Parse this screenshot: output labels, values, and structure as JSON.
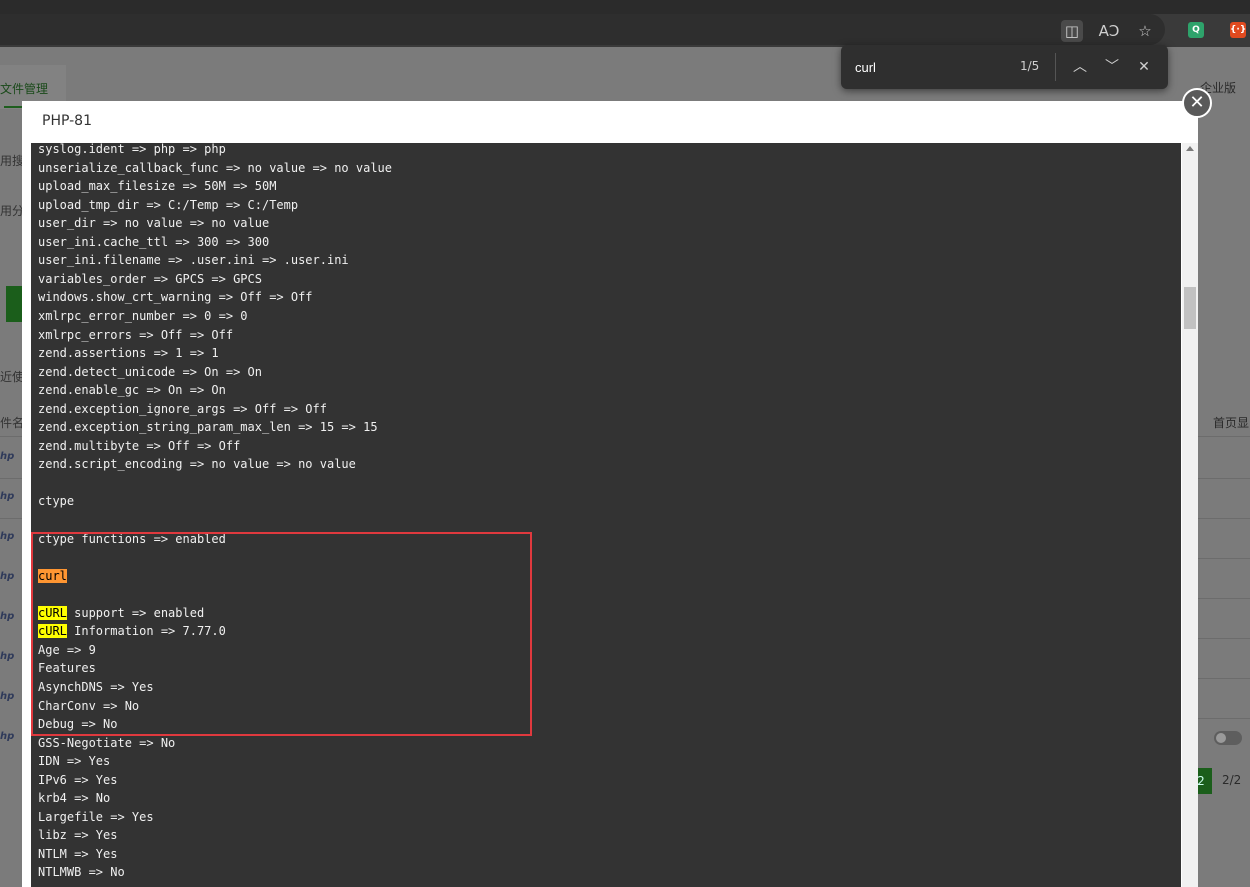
{
  "browser": {
    "toolbar_icons": [
      "find-on-page-icon",
      "read-aloud-icon",
      "favorite-icon"
    ],
    "extensions": [
      {
        "name": "green-extension-icon",
        "glyph": "Q",
        "color": "#2ea36b"
      },
      {
        "name": "red-extension-icon",
        "glyph": "{·}",
        "color": "#e04a1f"
      }
    ]
  },
  "find": {
    "query": "curl",
    "count": "1/5",
    "prev_glyph": "︿",
    "next_glyph": "﹀",
    "close_glyph": "✕"
  },
  "background": {
    "tab_label": "文件管理",
    "side_labels": [
      "用搜",
      "用分",
      "近使",
      "件名"
    ],
    "enterprise_label": "企业版",
    "home_label": "首页显",
    "current_page": "2",
    "total_pages": "2/2"
  },
  "modal": {
    "title": "PHP-81",
    "close_glyph": "✕",
    "lines": [
      {
        "t": "syslog.ident => php => php"
      },
      {
        "t": "unserialize_callback_func => no value => no value"
      },
      {
        "t": "upload_max_filesize => 50M => 50M"
      },
      {
        "t": "upload_tmp_dir => C:/Temp => C:/Temp"
      },
      {
        "t": "user_dir => no value => no value"
      },
      {
        "t": "user_ini.cache_ttl => 300 => 300"
      },
      {
        "t": "user_ini.filename => .user.ini => .user.ini"
      },
      {
        "t": "variables_order => GPCS => GPCS"
      },
      {
        "t": "windows.show_crt_warning => Off => Off"
      },
      {
        "t": "xmlrpc_error_number => 0 => 0"
      },
      {
        "t": "xmlrpc_errors => Off => Off"
      },
      {
        "t": "zend.assertions => 1 => 1"
      },
      {
        "t": "zend.detect_unicode => On => On"
      },
      {
        "t": "zend.enable_gc => On => On"
      },
      {
        "t": "zend.exception_ignore_args => Off => Off"
      },
      {
        "t": "zend.exception_string_param_max_len => 15 => 15"
      },
      {
        "t": "zend.multibyte => Off => Off"
      },
      {
        "t": "zend.script_encoding => no value => no value"
      },
      {
        "t": ""
      },
      {
        "t": "ctype"
      },
      {
        "t": ""
      },
      {
        "t": "ctype functions => enabled"
      },
      {
        "t": ""
      },
      {
        "hl_cur": "curl"
      },
      {
        "t": ""
      },
      {
        "hl": "cURL",
        "t": " support => enabled"
      },
      {
        "hl": "cURL",
        "t": " Information => 7.77.0"
      },
      {
        "t": "Age => 9"
      },
      {
        "t": "Features"
      },
      {
        "t": "AsynchDNS => Yes"
      },
      {
        "t": "CharConv => No"
      },
      {
        "t": "Debug => No"
      },
      {
        "t": "GSS-Negotiate => No"
      },
      {
        "t": "IDN => Yes"
      },
      {
        "t": "IPv6 => Yes"
      },
      {
        "t": "krb4 => No"
      },
      {
        "t": "Largefile => Yes"
      },
      {
        "t": "libz => Yes"
      },
      {
        "t": "NTLM => Yes"
      },
      {
        "t": "NTLMWB => No"
      }
    ]
  },
  "colors": {
    "highlight_match": "#ffff00",
    "highlight_current": "#ff9632",
    "annotation_box": "#e0393e",
    "terminal_bg": "#333333"
  }
}
